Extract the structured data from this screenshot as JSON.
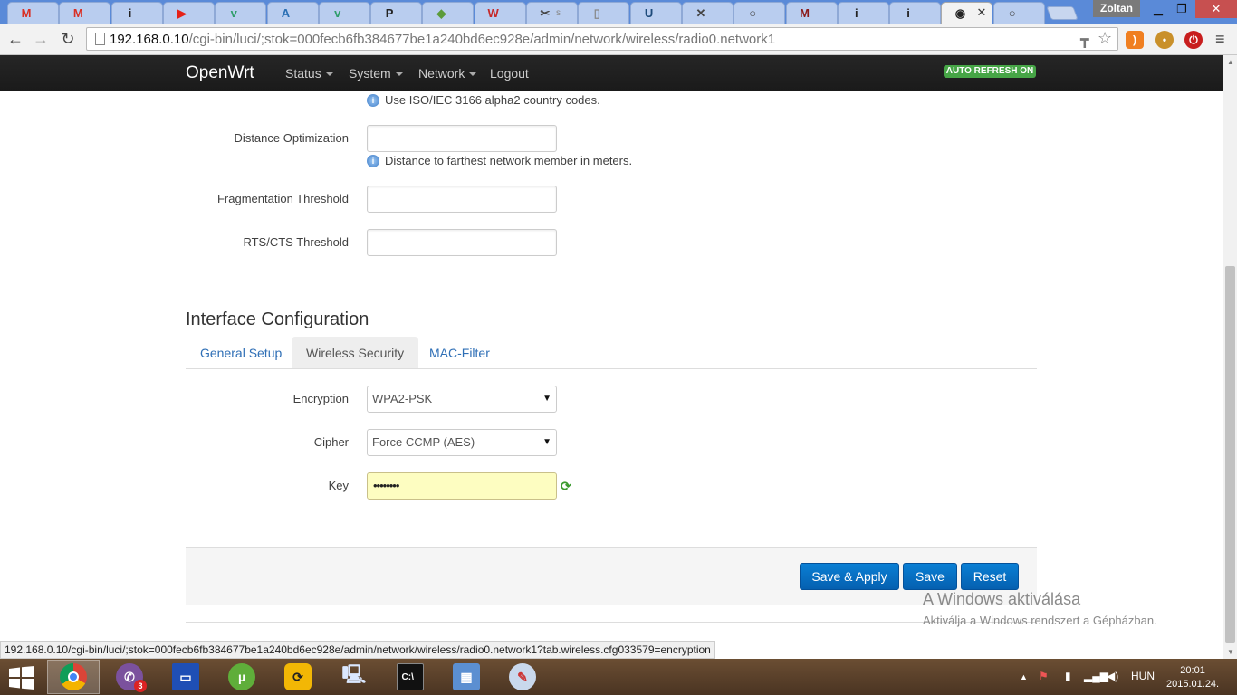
{
  "browser": {
    "tabs": [
      {
        "icon": "gmail-icon",
        "glyph": "M",
        "color": "#d93025",
        "title": ""
      },
      {
        "icon": "gmail-icon",
        "glyph": "M",
        "color": "#d93025",
        "title": ""
      },
      {
        "icon": "info-icon",
        "glyph": "i",
        "color": "#222",
        "title": ""
      },
      {
        "icon": "youtube-icon",
        "glyph": "▶",
        "color": "#e62117",
        "title": ""
      },
      {
        "icon": "vue-icon",
        "glyph": "v",
        "color": "#2e9d6a",
        "title": ""
      },
      {
        "icon": "angular-icon",
        "glyph": "A",
        "color": "#2a6fb4",
        "title": ""
      },
      {
        "icon": "vue-icon",
        "glyph": "v",
        "color": "#2e9d6a",
        "title": ""
      },
      {
        "icon": "terminal-icon",
        "glyph": "P",
        "color": "#222",
        "title": ""
      },
      {
        "icon": "maps-icon",
        "glyph": "◆",
        "color": "#5b9b3a",
        "title": ""
      },
      {
        "icon": "wh-icon",
        "glyph": "W",
        "color": "#c62828",
        "title": ""
      },
      {
        "icon": "tools-icon",
        "glyph": "✂",
        "color": "#444",
        "title": "s"
      },
      {
        "icon": "document-icon",
        "glyph": "▯",
        "color": "#888",
        "title": ""
      },
      {
        "icon": "shield-icon",
        "glyph": "U",
        "color": "#1d4a7a",
        "title": ""
      },
      {
        "icon": "tools-icon",
        "glyph": "✕",
        "color": "#444",
        "title": ""
      },
      {
        "icon": "search-icon",
        "glyph": "○",
        "color": "#444",
        "title": ""
      },
      {
        "icon": "gmail-icon",
        "glyph": "M",
        "color": "#8b1a1a",
        "title": ""
      },
      {
        "icon": "info-icon",
        "glyph": "i",
        "color": "#222",
        "title": ""
      },
      {
        "icon": "info-icon",
        "glyph": "i",
        "color": "#222",
        "title": ""
      },
      {
        "icon": "openwrt-icon",
        "glyph": "◉",
        "color": "#222",
        "title": ""
      },
      {
        "icon": "search-icon",
        "glyph": "○",
        "color": "#444",
        "title": ""
      }
    ],
    "active_tab_index": 18,
    "profile_name": "Zoltan",
    "url_host": "192.168.0.10",
    "url_path": "/cgi-bin/luci/;stok=000fecb6fb384677be1a240bd6ec928e/admin/network/wireless/radio0.network1",
    "status_bubble": "192.168.0.10/cgi-bin/luci/;stok=000fecb6fb384677be1a240bd6ec928e/admin/network/wireless/radio0.network1?tab.wireless.cfg033579=encryption"
  },
  "navbar": {
    "brand": "OpenWrt",
    "menus": [
      "Status",
      "System",
      "Network",
      "Logout"
    ],
    "refresh_badge": "AUTO REFRESH ON"
  },
  "form": {
    "country_hint": "Use ISO/IEC 3166 alpha2 country codes.",
    "distance_label": "Distance Optimization",
    "distance_value": "",
    "distance_hint": "Distance to farthest network member in meters.",
    "frag_label": "Fragmentation Threshold",
    "frag_value": "",
    "rts_label": "RTS/CTS Threshold",
    "rts_value": ""
  },
  "interface": {
    "title": "Interface Configuration",
    "tabs": [
      "General Setup",
      "Wireless Security",
      "MAC-Filter"
    ],
    "active_tab": "Wireless Security",
    "encryption_label": "Encryption",
    "encryption_value": "WPA2-PSK",
    "cipher_label": "Cipher",
    "cipher_value": "Force CCMP (AES)",
    "key_label": "Key",
    "key_value": "••••••••"
  },
  "actions": {
    "save_apply": "Save & Apply",
    "save": "Save",
    "reset": "Reset"
  },
  "activation": {
    "title": "A Windows aktiválása",
    "subtitle": "Aktiválja a Windows rendszert a Gépházban."
  },
  "taskbar": {
    "apps": [
      {
        "name": "chrome",
        "active": true
      },
      {
        "name": "viber",
        "badge": "3"
      },
      {
        "name": "floppy"
      },
      {
        "name": "utorrent"
      },
      {
        "name": "sync"
      },
      {
        "name": "network-tool"
      },
      {
        "name": "cmd"
      },
      {
        "name": "control-panel"
      },
      {
        "name": "paint"
      }
    ],
    "language": "HUN",
    "time": "20:01",
    "date": "2015.01.24."
  },
  "colors": {
    "link": "#2f6fb6",
    "button": "#0560b0",
    "navbar": "#222222",
    "badge_green": "#46a546",
    "key_bg": "#fdfdc1"
  }
}
